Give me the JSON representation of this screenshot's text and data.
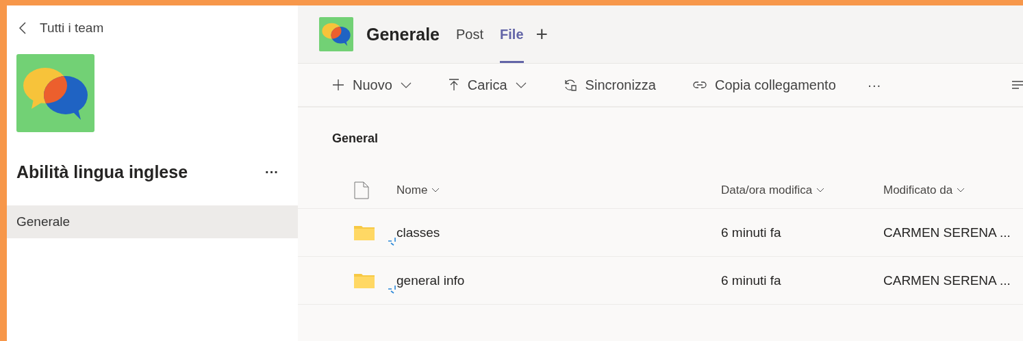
{
  "sidebar": {
    "back_label": "Tutti i team",
    "team_name": "Abilità lingua inglese",
    "more": "···",
    "channels": [
      {
        "label": "Generale",
        "selected": true
      }
    ]
  },
  "header": {
    "channel": "Generale",
    "tabs": [
      {
        "label": "Post",
        "selected": false
      },
      {
        "label": "File",
        "selected": true
      }
    ],
    "add_tab": "+"
  },
  "toolbar": {
    "items": [
      {
        "label": "Nuovo",
        "kind": "new",
        "dropdown": true
      },
      {
        "label": "Carica",
        "kind": "upload",
        "dropdown": true
      },
      {
        "label": "Sincronizza",
        "kind": "sync",
        "dropdown": false
      },
      {
        "label": "Copia collegamento",
        "kind": "link",
        "dropdown": false
      }
    ],
    "more": "···"
  },
  "breadcrumb": "General",
  "table": {
    "columns": [
      "Nome",
      "Data/ora modifica",
      "Modificato da"
    ],
    "rows": [
      {
        "name": "classes",
        "modified": "6 minuti fa",
        "modified_by": "CARMEN SERENA ...",
        "new": true
      },
      {
        "name": "general info",
        "modified": "6 minuti fa",
        "modified_by": "CARMEN SERENA ...",
        "new": true
      }
    ]
  }
}
